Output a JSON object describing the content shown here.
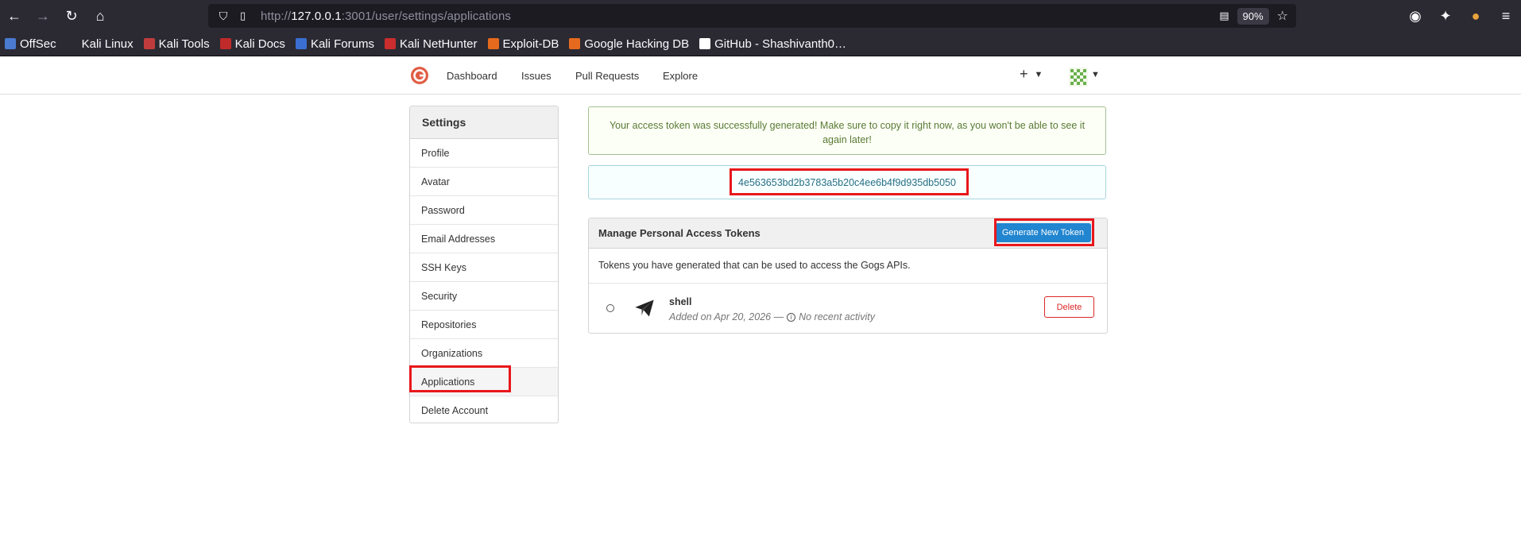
{
  "browser": {
    "url_prefix": "http://",
    "url_host": "127.0.0.1",
    "url_rest": ":3001/user/settings/applications",
    "zoom": "90%",
    "bookmarks": [
      {
        "label": "OffSec",
        "color": "#4a7bd1"
      },
      {
        "label": "Kali Linux",
        "color": "#2b2a33"
      },
      {
        "label": "Kali Tools",
        "color": "#c03c3c"
      },
      {
        "label": "Kali Docs",
        "color": "#c02a2a"
      },
      {
        "label": "Kali Forums",
        "color": "#3a6fd1"
      },
      {
        "label": "Kali NetHunter",
        "color": "#c92d2d"
      },
      {
        "label": "Exploit-DB",
        "color": "#e66a1e"
      },
      {
        "label": "Google Hacking DB",
        "color": "#e66a1e"
      },
      {
        "label": "GitHub - Shashivanth0…",
        "color": "#ffffff"
      }
    ]
  },
  "header": {
    "nav": [
      "Dashboard",
      "Issues",
      "Pull Requests",
      "Explore"
    ],
    "accent": "#e05d44"
  },
  "sidebar": {
    "title": "Settings",
    "items": [
      "Profile",
      "Avatar",
      "Password",
      "Email Addresses",
      "SSH Keys",
      "Security",
      "Repositories",
      "Organizations",
      "Applications",
      "Delete Account"
    ]
  },
  "main": {
    "success_message": "Your access token was successfully generated! Make sure to copy it right now, as you won't be able to see it again later!",
    "token_value": "4e563653bd2b3783a5b20c4ee6b4f9d935db5050",
    "panel_title": "Manage Personal Access Tokens",
    "generate_label": "Generate New Token",
    "description": "Tokens you have generated that can be used to access the Gogs APIs.",
    "token": {
      "name": "shell",
      "added": "Added on Apr 20, 2026 —",
      "activity": "No recent activity",
      "delete_label": "Delete"
    }
  }
}
